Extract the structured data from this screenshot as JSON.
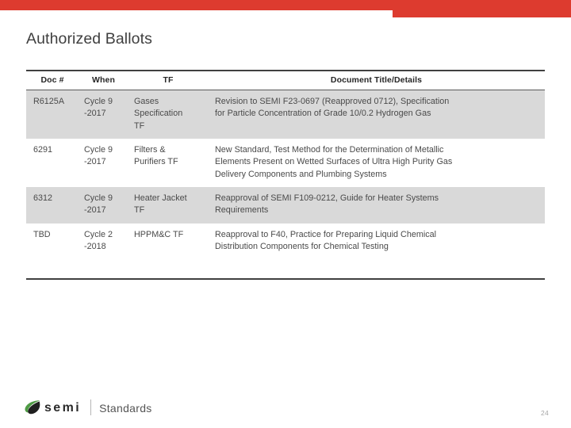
{
  "theme": {
    "banner_color": "#dd3b2f",
    "title_color": "#3f3f3f",
    "row_shade_color": "#d9d9d9",
    "rule_color": "#404040",
    "logo_green": "#4f9b45",
    "logo_dark": "#1f1f1f"
  },
  "header": {
    "title": "Authorized Ballots"
  },
  "table": {
    "columns": [
      {
        "key": "doc",
        "label": "Doc #"
      },
      {
        "key": "when",
        "label": "When"
      },
      {
        "key": "tf",
        "label": "TF"
      },
      {
        "key": "title",
        "label": "Document Title/Details"
      }
    ],
    "rows": [
      {
        "doc": "R6125A",
        "when_line1": "Cycle 9",
        "when_line2": "-2017",
        "tf_line1": "Gases",
        "tf_line2": "Specification",
        "tf_line3": "TF",
        "title_line1": "Revision to SEMI F23-0697 (Reapproved 0712), Specification",
        "title_line2": "for Particle Concentration of Grade 10/0.2 Hydrogen Gas",
        "title_line3": "",
        "shaded": true
      },
      {
        "doc": "6291",
        "when_line1": "Cycle 9",
        "when_line2": "-2017",
        "tf_line1": "Filters &",
        "tf_line2": "Purifiers TF",
        "tf_line3": "",
        "title_line1": "New Standard, Test Method for the Determination of Metallic",
        "title_line2": "Elements Present on Wetted Surfaces of Ultra High Purity Gas",
        "title_line3": "Delivery Components and Plumbing Systems",
        "shaded": false
      },
      {
        "doc": "6312",
        "when_line1": "Cycle 9",
        "when_line2": "-2017",
        "tf_line1": "Heater Jacket",
        "tf_line2": "TF",
        "tf_line3": "",
        "title_line1": "Reapproval of SEMI F109-0212, Guide for Heater Systems",
        "title_line2": "Requirements",
        "title_line3": "",
        "shaded": true
      },
      {
        "doc": "TBD",
        "when_line1": "Cycle 2",
        "when_line2": "-2018",
        "tf_line1": "HPPM&C TF",
        "tf_line2": "",
        "tf_line3": "",
        "title_line1": "Reapproval to F40, Practice for Preparing Liquid Chemical",
        "title_line2": "Distribution Components for Chemical Testing",
        "title_line3": "",
        "shaded": false
      }
    ]
  },
  "footer": {
    "logo_word": "semi",
    "logo_suffix": "Standards",
    "page_number": "24"
  }
}
